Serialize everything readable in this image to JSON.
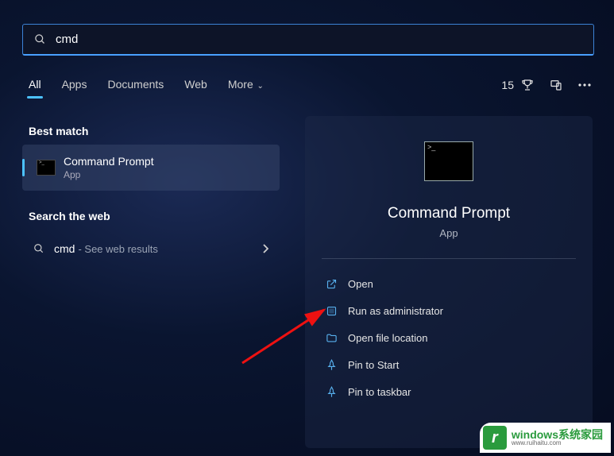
{
  "search": {
    "query": "cmd"
  },
  "tabs": {
    "all": "All",
    "apps": "Apps",
    "documents": "Documents",
    "web": "Web",
    "more": "More"
  },
  "right_status": {
    "count": "15"
  },
  "sections": {
    "best_match": "Best match",
    "search_web": "Search the web"
  },
  "best_match_result": {
    "title": "Command Prompt",
    "subtitle": "App"
  },
  "web_result": {
    "term": "cmd",
    "desc": "- See web results"
  },
  "preview": {
    "title": "Command Prompt",
    "subtitle": "App",
    "actions": {
      "open": "Open",
      "run_admin": "Run as administrator",
      "open_location": "Open file location",
      "pin_start": "Pin to Start",
      "pin_taskbar": "Pin to taskbar"
    }
  },
  "watermark": {
    "big": "windows系统家园",
    "small": "www.ruihaitu.com"
  }
}
